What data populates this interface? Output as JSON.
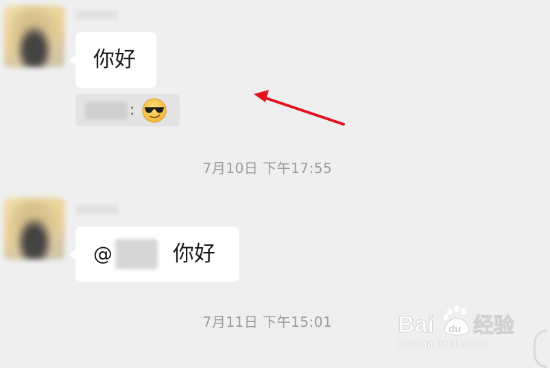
{
  "chat": {
    "message1": {
      "text": "你好",
      "reaction_separator": ":",
      "reaction_icon": "sunglasses-emoji-icon"
    },
    "timestamp1": "7月10日 下午17:55",
    "message2": {
      "mention_prefix": "@",
      "text": "你好"
    },
    "timestamp2": "7月11日 下午15:01"
  },
  "annotation": {
    "arrow_color": "#e0141e"
  },
  "watermark": {
    "logo_label": "Bai du 经验",
    "url": "jingyan.baidu.com"
  },
  "colors": {
    "background": "#efefef",
    "bubble": "#ffffff",
    "reaction_bg": "#e3e3e3",
    "timestamp_text": "#9a9a9a"
  }
}
